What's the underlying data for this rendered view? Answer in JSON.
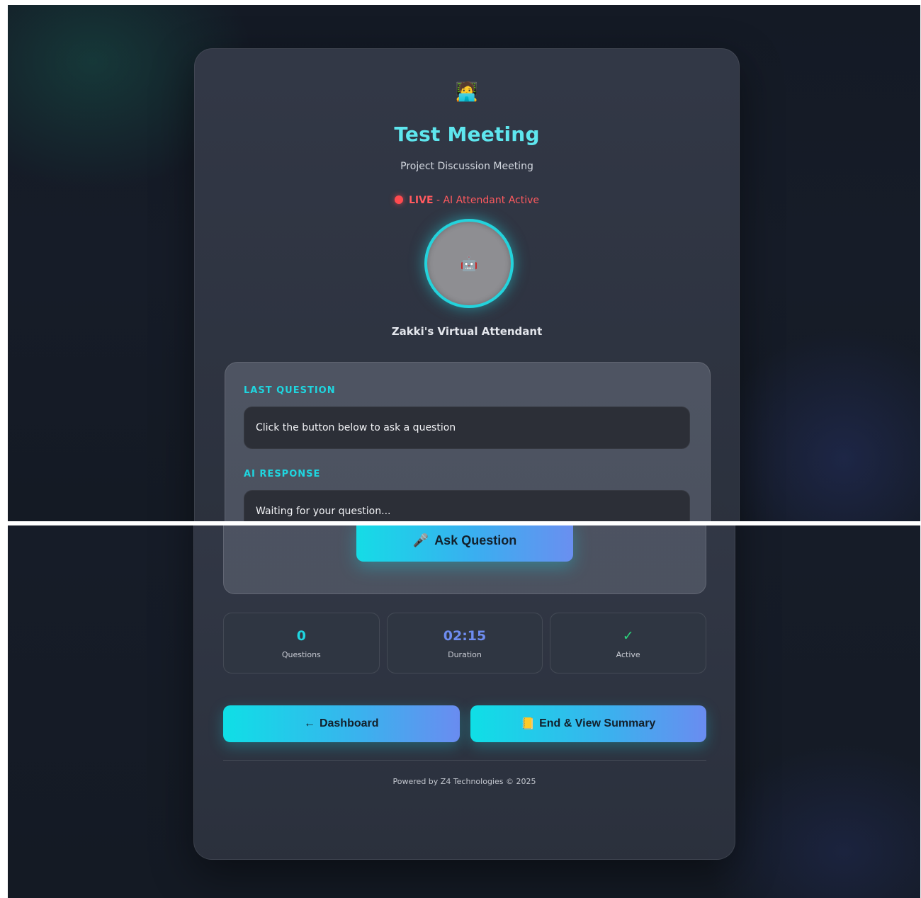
{
  "meeting": {
    "avatar_icon": "🧑‍💻",
    "title": "Test Meeting",
    "subtitle": "Project Discussion Meeting",
    "status_live": "LIVE",
    "status_detail": " - AI Attendant Active",
    "attendant_icon": "🤖",
    "attendant_name": "Zakki's Virtual Attendant"
  },
  "qa": {
    "question_label": "LAST QUESTION",
    "question_text": "Click the button below to ask a question",
    "response_label": "AI RESPONSE",
    "response_text": "Waiting for your question...",
    "ask_icon": "🎤",
    "ask_label": "Ask Question"
  },
  "stats": [
    {
      "value": "0",
      "label": "Questions"
    },
    {
      "value": "02:15",
      "label": "Duration"
    },
    {
      "value": "✓",
      "label": "Active"
    }
  ],
  "actions": {
    "dashboard_icon": "←",
    "dashboard_label": "Dashboard",
    "summary_icon": "📒",
    "summary_label": "End & View Summary"
  },
  "footer": "Powered by Z4 Technologies © 2025",
  "colors": {
    "accent": "#1fd6e0",
    "live": "#ff4a4f",
    "duration": "#6e8cf0",
    "active": "#2bd47c"
  }
}
